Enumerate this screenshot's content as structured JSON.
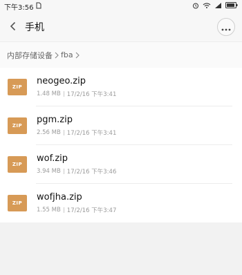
{
  "status_bar": {
    "time": "下午3:56",
    "icons": [
      "sim-icon",
      "alarm-icon",
      "wifi-icon",
      "signal-icon",
      "battery-icon"
    ]
  },
  "header": {
    "title": "手机",
    "back_icon": "chevron-left-icon",
    "more_icon": "more-dots-icon"
  },
  "breadcrumb": {
    "items": [
      "内部存储设备",
      "fba"
    ]
  },
  "files": [
    {
      "icon_label": "ZIP",
      "name": "neogeo.zip",
      "size": "1.48 MB",
      "date": "17/2/16 下午3:41"
    },
    {
      "icon_label": "ZIP",
      "name": "pgm.zip",
      "size": "2.56 MB",
      "date": "17/2/16 下午3:41"
    },
    {
      "icon_label": "ZIP",
      "name": "wof.zip",
      "size": "3.94 MB",
      "date": "17/2/16 下午3:46"
    },
    {
      "icon_label": "ZIP",
      "name": "wofjha.zip",
      "size": "1.55 MB",
      "date": "17/2/16 下午3:47"
    }
  ],
  "colors": {
    "zip_icon": "#d79a56",
    "background": "#f2f2f2",
    "list_background": "#ffffff"
  }
}
